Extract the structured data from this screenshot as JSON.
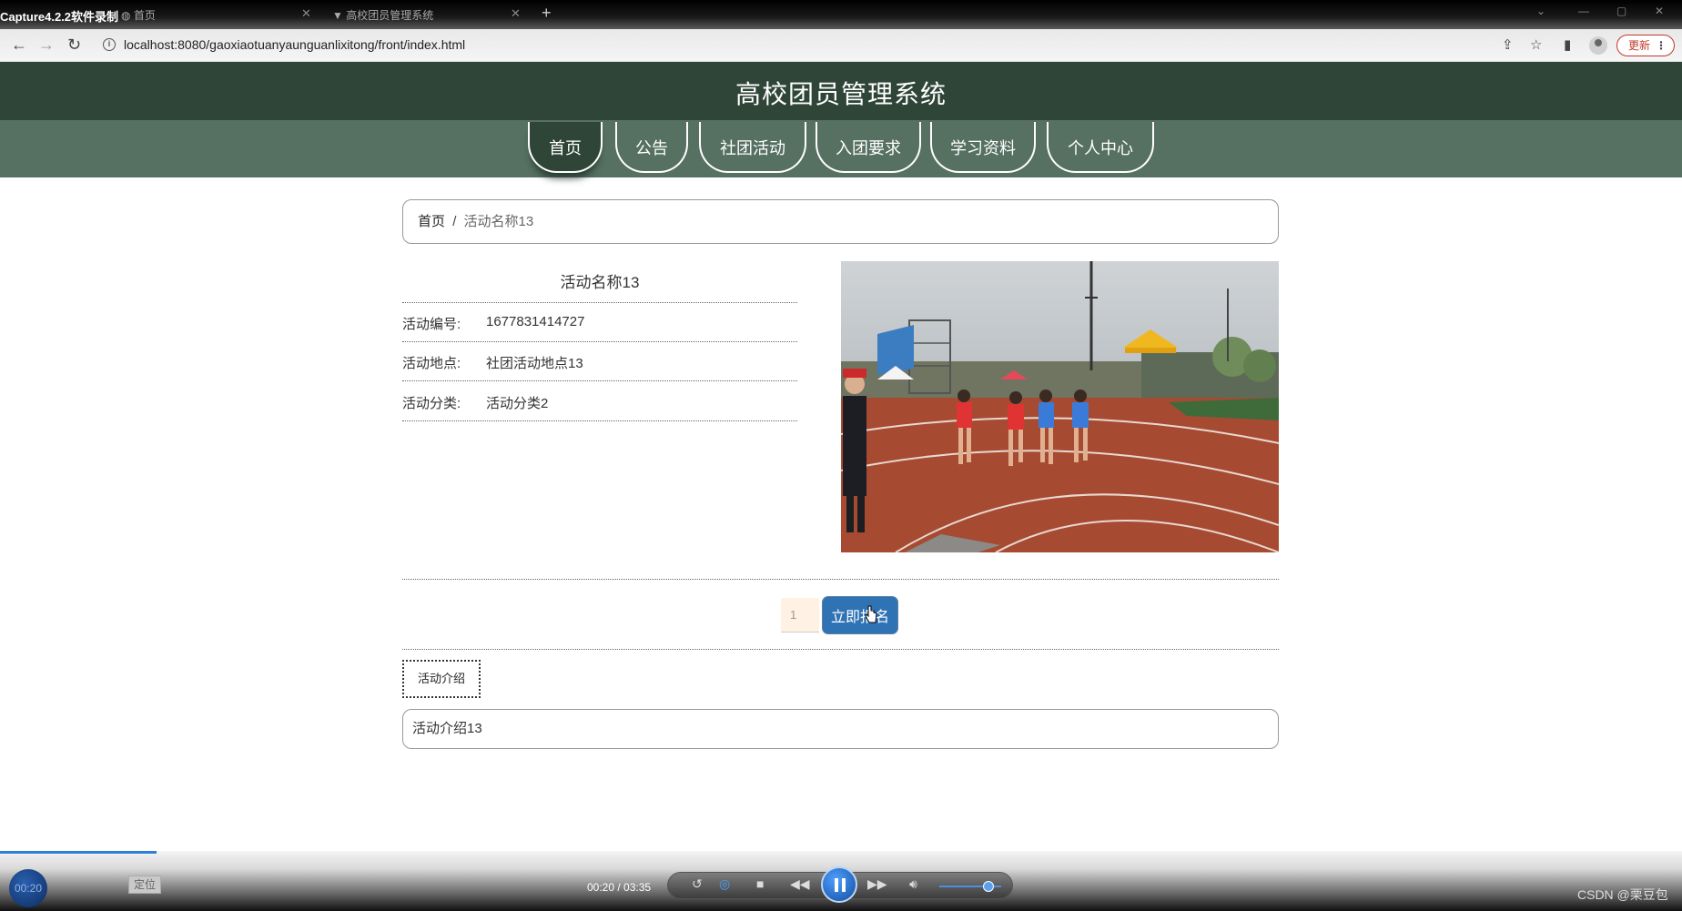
{
  "recorder": {
    "title": "Capture4.2.2软件录制",
    "tabs": [
      {
        "label": "首页"
      },
      {
        "label": "高校团员管理系统"
      }
    ]
  },
  "browser": {
    "url": "localhost:8080/gaoxiaotuanyaunguanlixitong/front/index.html",
    "update_label": "更新"
  },
  "site": {
    "title": "高校团员管理系统",
    "nav": [
      {
        "label": "首页",
        "active": true
      },
      {
        "label": "公告",
        "active": false
      },
      {
        "label": "社团活动",
        "active": false
      },
      {
        "label": "入团要求",
        "active": false
      },
      {
        "label": "学习资料",
        "active": false
      },
      {
        "label": "个人中心",
        "active": false
      }
    ]
  },
  "breadcrumb": {
    "home": "首页",
    "separator": "/",
    "current": "活动名称13"
  },
  "detail": {
    "title": "活动名称13",
    "fields": [
      {
        "label": "活动编号:",
        "value": "1677831414727"
      },
      {
        "label": "活动地点:",
        "value": "社团活动地点13"
      },
      {
        "label": "活动分类:",
        "value": "活动分类2"
      }
    ]
  },
  "signup": {
    "quantity": "1",
    "button_label": "立即报名"
  },
  "intro": {
    "tab_label": "活动介绍",
    "content": "活动介绍13"
  },
  "player": {
    "elapsed_badge": "00:20",
    "locate_label": "定位",
    "time": "00:20 / 03:35",
    "progress_fraction": 0.093,
    "volume_fraction": 0.8,
    "watermark": "CSDN @栗豆包"
  },
  "colors": {
    "header_bg": "#2f4538",
    "nav_band": "#567062",
    "button_blue": "#2f73b5"
  }
}
